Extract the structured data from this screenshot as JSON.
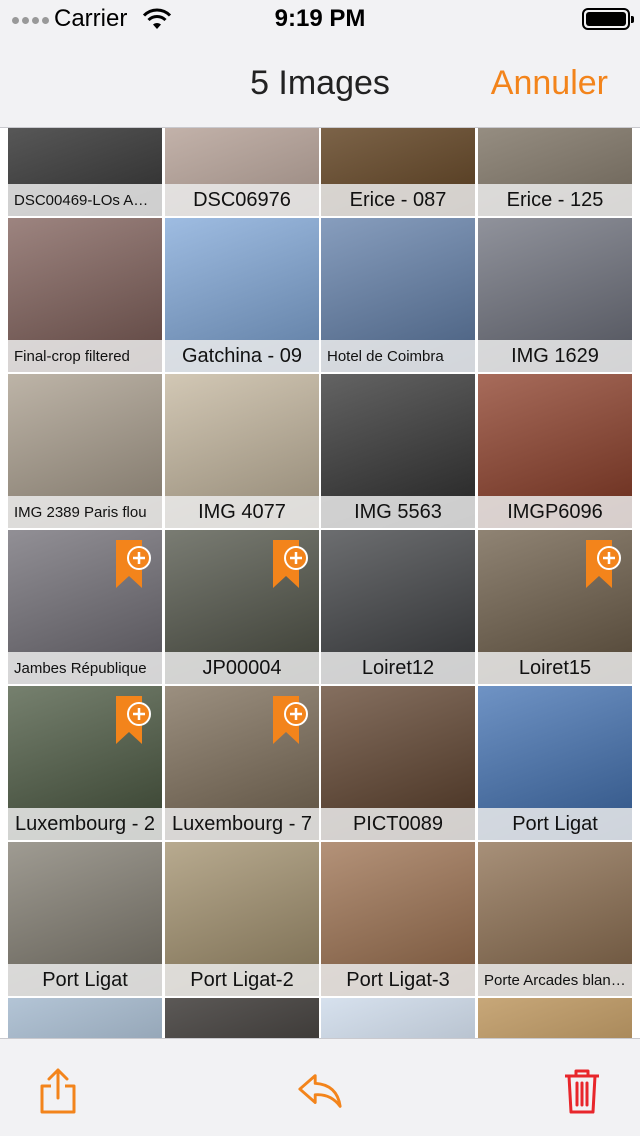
{
  "status": {
    "carrier": "Carrier",
    "time": "9:19 PM"
  },
  "nav": {
    "title": "5 Images",
    "cancel": "Annuler"
  },
  "colors": {
    "accent": "#f3841b",
    "delete": "#e8262b"
  },
  "tiles": [
    {
      "caption": "DSC00469-LOs Ang…",
      "bg": "#3a3a3a",
      "size": "s"
    },
    {
      "caption": "DSC06976",
      "bg": "#c9b3a8",
      "size": "l"
    },
    {
      "caption": "Erice - 087",
      "bg": "#6b4a26",
      "size": "l"
    },
    {
      "caption": "Erice - 125",
      "bg": "#8d8272",
      "size": "l"
    },
    {
      "caption": "Final-crop filtered",
      "bg": "#7c5b55",
      "size": "s"
    },
    {
      "caption": "Gatchina - 09",
      "bg": "#7ea6d8",
      "size": "l"
    },
    {
      "caption": "Hotel de Coimbra",
      "bg": "#5f7da8",
      "size": "s"
    },
    {
      "caption": "IMG 1629",
      "bg": "#6b6e7a",
      "size": "l"
    },
    {
      "caption": "IMG 2389 Paris flou",
      "bg": "#a79b8a",
      "size": "s"
    },
    {
      "caption": "IMG 4077",
      "bg": "#c3b59c",
      "size": "l"
    },
    {
      "caption": "IMG 5563",
      "bg": "#2f2f2f",
      "size": "l"
    },
    {
      "caption": "IMGP6096",
      "bg": "#8a3a24",
      "size": "l"
    },
    {
      "caption": "Jambes République",
      "bg": "#6d6a72",
      "size": "s",
      "mark": true
    },
    {
      "caption": "JP00004",
      "bg": "#4d5044",
      "size": "l",
      "mark": true
    },
    {
      "caption": "Loiret12",
      "bg": "#3b3d40",
      "size": "l"
    },
    {
      "caption": "Loiret15",
      "bg": "#6a5a45",
      "size": "l",
      "mark": true
    },
    {
      "caption": "Luxembourg - 2",
      "bg": "#48563e",
      "size": "l",
      "mark": true
    },
    {
      "caption": "Luxembourg - 7",
      "bg": "#7a6a55",
      "size": "l",
      "mark": true
    },
    {
      "caption": "PICT0089",
      "bg": "#5c3f2a",
      "size": "l"
    },
    {
      "caption": "Port Ligat",
      "bg": "#3f6fb1",
      "size": "l"
    },
    {
      "caption": "Port Ligat",
      "bg": "#7f7a6e",
      "size": "l"
    },
    {
      "caption": "Port Ligat-2",
      "bg": "#a08e6a",
      "size": "l"
    },
    {
      "caption": "Port Ligat-3",
      "bg": "#9b6e4c",
      "size": "l"
    },
    {
      "caption": "Porte Arcades blanc…",
      "bg": "#8a6b4c",
      "size": "s"
    },
    {
      "caption": "",
      "bg": "#9ab1c8",
      "size": "l"
    },
    {
      "caption": "",
      "bg": "#25211e",
      "size": "l"
    },
    {
      "caption": "",
      "bg": "#c9d7e8",
      "size": "l"
    },
    {
      "caption": "",
      "bg": "#b58a4c",
      "size": "l"
    }
  ],
  "toolbar": {
    "share": "share-icon",
    "reply": "reply-icon",
    "delete": "trash-icon"
  }
}
